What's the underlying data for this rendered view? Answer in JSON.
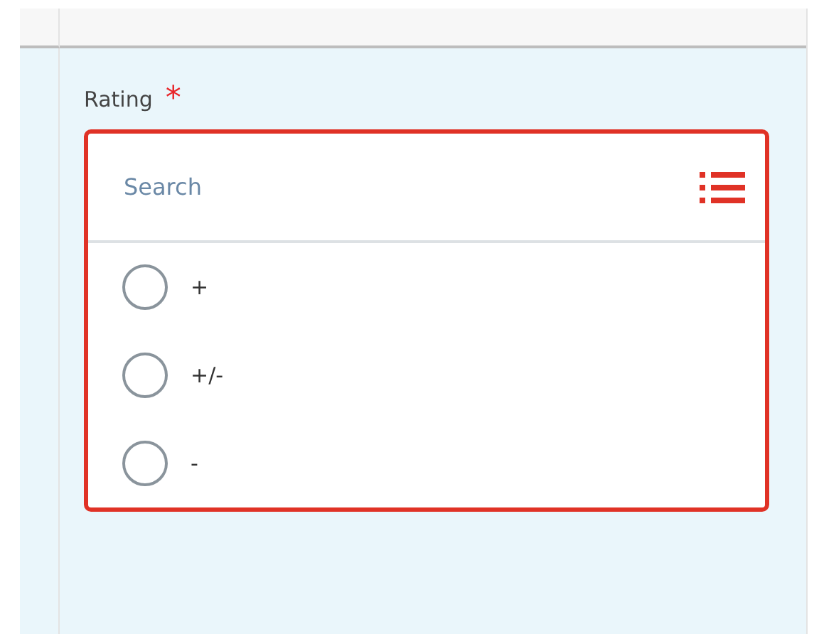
{
  "field": {
    "label": "Rating",
    "required_mark": "*"
  },
  "search": {
    "placeholder": "Search"
  },
  "options": [
    {
      "label": "+",
      "selected": false
    },
    {
      "label": "+/-",
      "selected": false
    },
    {
      "label": "-",
      "selected": false
    }
  ]
}
